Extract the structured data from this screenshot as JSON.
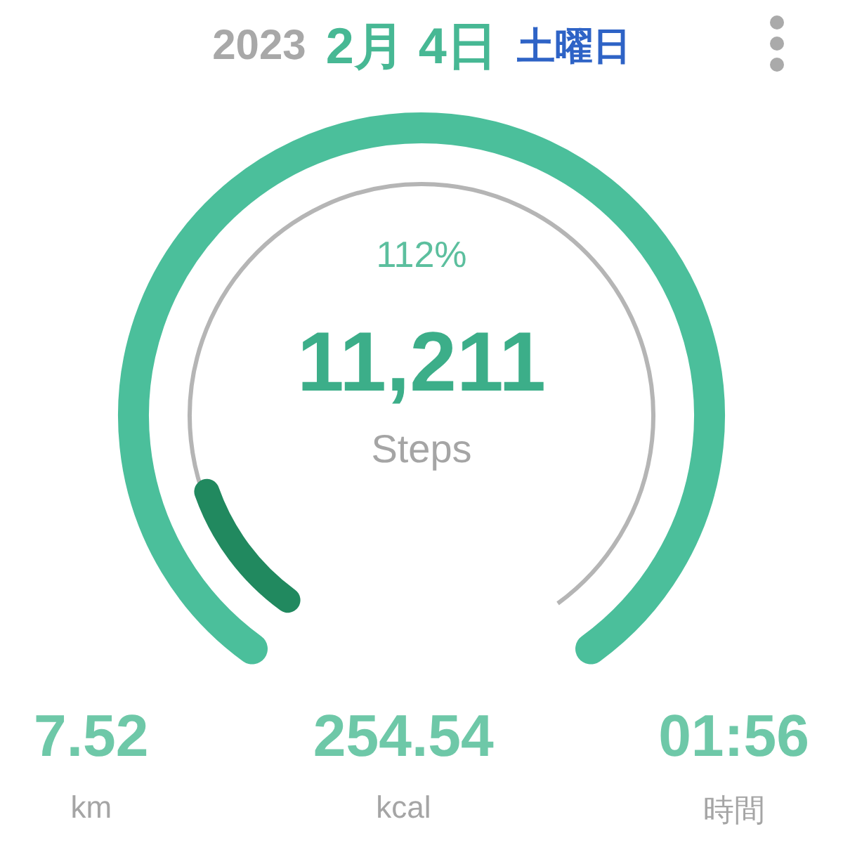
{
  "header": {
    "year": "2023",
    "date": "2月 4日",
    "weekday": "土曜日"
  },
  "gauge": {
    "percent": "112%",
    "value": "11,211",
    "unit": "Steps",
    "level": 0.12
  },
  "stats": [
    {
      "value": "7.52",
      "label": "km"
    },
    {
      "value": "254.54",
      "label": "kcal"
    },
    {
      "value": "01:56",
      "label": "時間"
    }
  ]
}
